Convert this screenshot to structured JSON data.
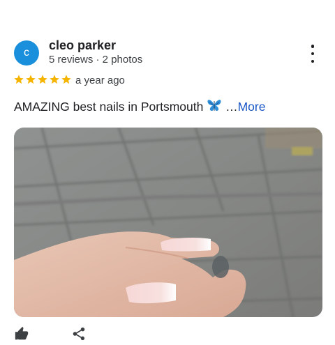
{
  "reviewer": {
    "initial": "c",
    "name": "cleo parker",
    "meta": "5 reviews · 2 photos",
    "avatar_color": "#1a8fdc"
  },
  "rating": {
    "stars": 5,
    "max": 5,
    "star_color": "#f4b400"
  },
  "time": "a year ago",
  "review": {
    "text": "AMAZING best nails in Portsmouth",
    "ellipsis": "…",
    "more_label": "More",
    "emoji_icon": "butterfly-icon"
  },
  "photo": {
    "subject": "photo-icon"
  },
  "icons": {
    "menu": "more-vert-icon",
    "like": "thumb-up-icon",
    "share": "share-icon"
  },
  "colors": {
    "link": "#1a57c6",
    "text": "#202124"
  }
}
